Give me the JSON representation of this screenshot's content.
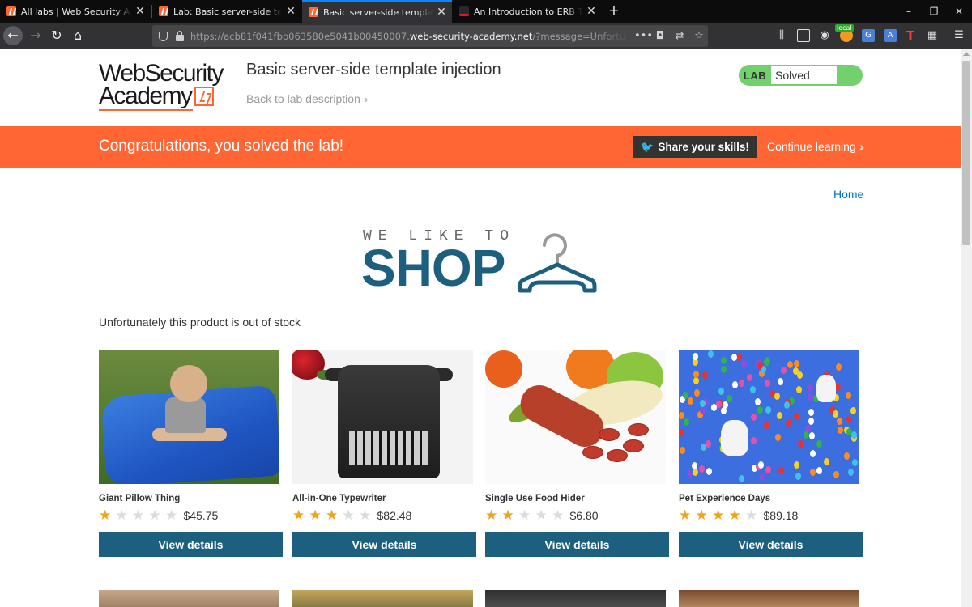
{
  "browser": {
    "tabs": [
      {
        "title": "All labs | Web Security Academy",
        "icon": "portswigger-icon",
        "active": false
      },
      {
        "title": "Lab: Basic server-side template injection",
        "icon": "portswigger-icon",
        "active": false
      },
      {
        "title": "Basic server-side template injection",
        "icon": "portswigger-icon",
        "active": true
      },
      {
        "title": "An Introduction to ERB Templating",
        "icon": "page-icon",
        "active": false
      }
    ],
    "new_tab_label": "+",
    "url_prefix": "https://acb81f041fbb063580e5041b00450007.",
    "url_host": "web-security-academy.net",
    "url_suffix": "/?message=Unfortunately this product is out of stock",
    "overflow_label": "•••",
    "window_controls": {
      "minimize": "–",
      "restore": "❐",
      "close": "✕"
    },
    "extension_badge": "local"
  },
  "header": {
    "logo_line1": "WebSecurity",
    "logo_line2": "Academy",
    "lab_title": "Basic server-side template injection",
    "back_link": "Back to lab description",
    "status_label": "LAB",
    "status_value": "Solved"
  },
  "banner": {
    "message": "Congratulations, you solved the lab!",
    "share_button": "Share your skills!",
    "continue_link": "Continue learning"
  },
  "nav": {
    "home_link": "Home"
  },
  "shop_logo": {
    "tagline": "WE LIKE TO",
    "word": "SHOP"
  },
  "message": "Unfortunately this product is out of stock",
  "products": [
    {
      "name": "Giant Pillow Thing",
      "rating": 1,
      "price": "$45.75",
      "button": "View details"
    },
    {
      "name": "All-in-One Typewriter",
      "rating": 3,
      "price": "$82.48",
      "button": "View details"
    },
    {
      "name": "Single Use Food Hider",
      "rating": 2,
      "price": "$6.80",
      "button": "View details"
    },
    {
      "name": "Pet Experience Days",
      "rating": 4,
      "price": "$89.18",
      "button": "View details"
    }
  ],
  "colors": {
    "brand_orange": "#ff6633",
    "shop_blue": "#1c5f7f",
    "solved_green": "#70d16d",
    "link_blue": "#0071bc",
    "star_gold": "#f3a31a"
  }
}
